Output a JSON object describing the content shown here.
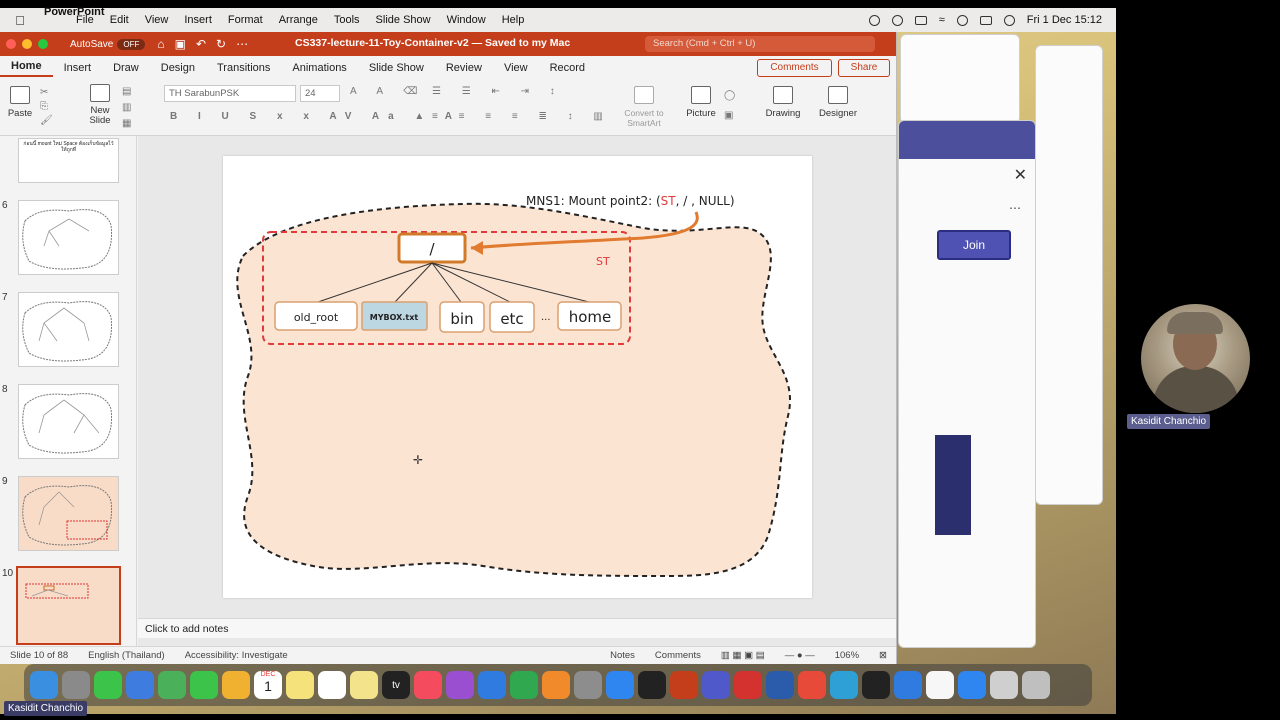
{
  "menubar": {
    "app": "PowerPoint",
    "items": [
      "File",
      "Edit",
      "View",
      "Insert",
      "Format",
      "Arrange",
      "Tools",
      "Slide Show",
      "Window",
      "Help"
    ],
    "datetime": "Fri 1 Dec  15:12"
  },
  "titlebar": {
    "autosave": "AutoSave",
    "toggle": "OFF",
    "document": "CS337-lecture-11-Toy-Container-v2 — Saved to my Mac",
    "search_placeholder": "Search (Cmd + Ctrl + U)"
  },
  "tabs": [
    "Home",
    "Insert",
    "Draw",
    "Design",
    "Transitions",
    "Animations",
    "Slide Show",
    "Review",
    "View",
    "Record"
  ],
  "active_tab": "Home",
  "actions": {
    "comments": "Comments",
    "share": "Share"
  },
  "ribbon": {
    "paste": "Paste",
    "new_slide": "New\nSlide",
    "font_name": "TH SarabunPSK",
    "font_size": "24",
    "convert": "Convert to\nSmartArt",
    "picture": "Picture",
    "drawing": "Drawing",
    "designer": "Designer"
  },
  "thumbnails": {
    "numbers": [
      "6",
      "7",
      "8",
      "9",
      "10"
    ],
    "first_text": "ก่อนนี้ mount ใหม่ Space ต้องเก็บข้อมูลไว้ให้ถูกที่"
  },
  "slide": {
    "heading": "MNS1: Mount point2: (",
    "heading_st": "ST",
    "heading_tail": ", /  , NULL)",
    "root": "/",
    "st_label": "ST",
    "nodes": [
      "old_root",
      "MYBOX.txt",
      "bin",
      "etc",
      "...",
      "home"
    ]
  },
  "notes": "Click to add notes",
  "status": {
    "slide": "Slide 10 of 88",
    "language": "English (Thailand)",
    "accessibility": "Accessibility: Investigate",
    "notes": "Notes",
    "comments": "Comments",
    "zoom": "106%"
  },
  "teams": {
    "join": "Join"
  },
  "participant": {
    "name": "Kasidit  Chanchio",
    "self_name": "Kasidit  Chanchio"
  },
  "dock_apps": [
    "finder-icon",
    "launchpad-icon",
    "messages-icon",
    "mail-icon",
    "maps-icon",
    "facetime-icon",
    "photos-icon",
    "calendar-icon",
    "notes-icon",
    "reminders-icon",
    "stickies-icon",
    "tv-icon",
    "music-icon",
    "podcasts-icon",
    "keynote-icon",
    "numbers-icon",
    "pages-icon",
    "settings-icon",
    "appstore-icon",
    "terminal-icon",
    "powerpoint-icon",
    "teams-icon",
    "acrobat-icon",
    "word-icon",
    "chrome-icon",
    "edge-icon",
    "inkscape-icon",
    "vscode-icon",
    "textedit-icon",
    "safari-icon",
    "preview-icon",
    "trash-icon"
  ],
  "dock_colors": [
    "#3a8fe0",
    "#8a8a8a",
    "#3bc34a",
    "#3f7ce0",
    "#4bb05a",
    "#3bc34a",
    "#f0b030",
    "#ffffff",
    "#f5e27a",
    "#ffffff",
    "#f3e38a",
    "#222222",
    "#f44b5e",
    "#9a4fd0",
    "#2f7be0",
    "#2fa84f",
    "#f08a2a",
    "#8d8d8d",
    "#2f86f0",
    "#222222",
    "#c43e1c",
    "#5059c9",
    "#d3322f",
    "#2b5cab",
    "#e84a3a",
    "#2fa0d6",
    "#222222",
    "#2f7be0",
    "#f7f7f7",
    "#2f86f0",
    "#cfcfcf",
    "#bfbfbf"
  ],
  "dock_labels": {
    "calendar": "1",
    "calendar_month": "DEC",
    "tv": "tv"
  }
}
